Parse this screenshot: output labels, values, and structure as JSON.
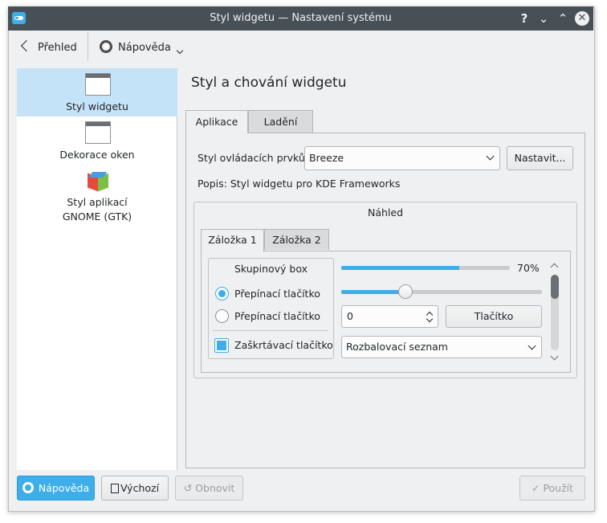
{
  "window": {
    "title": "Styl widgetu  — Nastavení systému",
    "help_glyph": "?",
    "min_glyph": "⌄",
    "max_glyph": "⌃",
    "close_glyph": "✕"
  },
  "toolbar": {
    "back_label": "Přehled",
    "help_label": "Nápověda"
  },
  "sidebar": {
    "items": [
      {
        "label": "Styl widgetu",
        "icon": "window-style-icon",
        "active": true
      },
      {
        "label": "Dekorace oken",
        "icon": "window-decoration-icon",
        "active": false
      },
      {
        "label": "Styl aplikací GNOME (GTK)",
        "icon": "gtk-icon",
        "active": false
      }
    ]
  },
  "main": {
    "title": "Styl a chování widgetu",
    "tabs": [
      "Aplikace",
      "Ladění"
    ],
    "style_label": "Styl ovládacích prvků:",
    "style_value": "Breeze",
    "configure_label": "Nastavit...",
    "description": "Popis: Styl widgetu pro KDE Frameworks",
    "preview": {
      "title": "Náhled",
      "tabs": [
        "Záložka 1",
        "Záložka 2"
      ],
      "groupbox_title": "Skupinový box",
      "radio1_label": "Přepínací tlačítko",
      "radio1_checked": true,
      "radio2_label": "Přepínací tlačítko",
      "radio2_checked": false,
      "checkbox_label": "Zaškrtávací tlačítko",
      "checkbox_checked": true,
      "progress_percent": 70,
      "progress_label": "70%",
      "slider_fraction": 0.32,
      "spin_value": "0",
      "button_label": "Tlačítko",
      "combo_label": "Rozbalovací seznam"
    }
  },
  "footer": {
    "help_label": "Nápověda",
    "defaults_label": "Výchozí",
    "reset_label": "Obnovit",
    "apply_label": "Použít"
  },
  "colors": {
    "accent": "#3daee9",
    "titlebar": "#475057",
    "window_bg": "#eff0f1",
    "selection": "#c4e3f8"
  }
}
